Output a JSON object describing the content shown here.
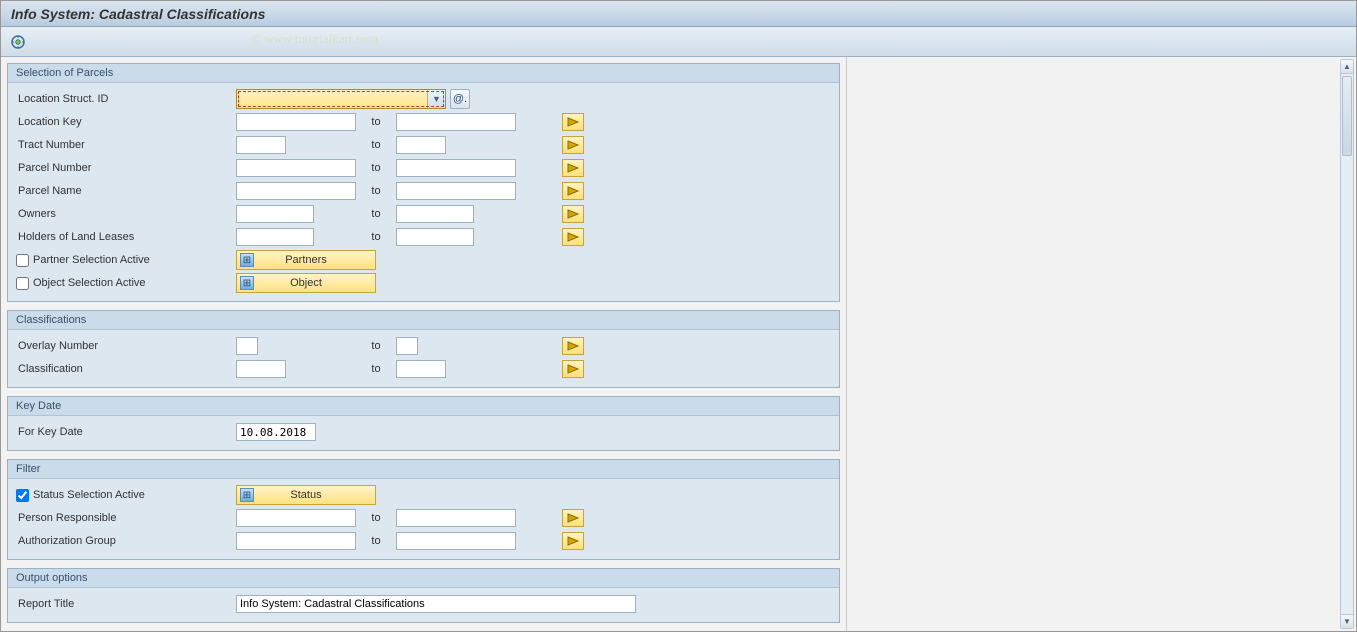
{
  "window": {
    "title": "Info System: Cadastral Classifications"
  },
  "watermark": "© www.tutorialkart.com",
  "groups": {
    "parcels": {
      "title": "Selection of Parcels",
      "location_struct_id_label": "Location Struct. ID",
      "location_key_label": "Location Key",
      "tract_number_label": "Tract Number",
      "parcel_number_label": "Parcel Number",
      "parcel_name_label": "Parcel Name",
      "owners_label": "Owners",
      "holders_label": "Holders of Land Leases",
      "partner_sel_label": "Partner Selection Active",
      "object_sel_label": "Object Selection Active",
      "partners_btn": "Partners",
      "object_btn": "Object",
      "to_label": "to"
    },
    "classifications": {
      "title": "Classifications",
      "overlay_label": "Overlay Number",
      "class_label": "Classification",
      "to_label": "to"
    },
    "keydate": {
      "title": "Key Date",
      "for_key_date_label": "For Key Date",
      "for_key_date_value": "10.08.2018"
    },
    "filter": {
      "title": "Filter",
      "status_sel_label": "Status Selection Active",
      "status_btn": "Status",
      "person_resp_label": "Person Responsible",
      "auth_group_label": "Authorization Group",
      "to_label": "to"
    },
    "output": {
      "title": "Output options",
      "report_title_label": "Report Title",
      "report_title_value": "Info System: Cadastral Classifications"
    }
  },
  "help_btn_text": "@."
}
